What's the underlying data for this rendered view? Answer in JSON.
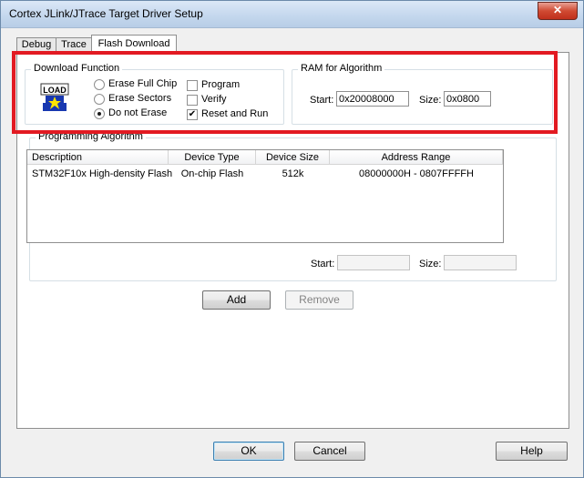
{
  "window": {
    "title": "Cortex JLink/JTrace Target Driver Setup",
    "close_glyph": "✕"
  },
  "tabs": [
    {
      "label": "Debug",
      "active": false
    },
    {
      "label": "Trace",
      "active": false
    },
    {
      "label": "Flash Download",
      "active": true
    }
  ],
  "download_function": {
    "label": "Download Function",
    "icon": "load-icon",
    "icon_text": "LOAD",
    "radios": [
      {
        "label": "Erase Full Chip",
        "selected": false
      },
      {
        "label": "Erase Sectors",
        "selected": false
      },
      {
        "label": "Do not Erase",
        "selected": true
      }
    ],
    "checks": [
      {
        "label": "Program",
        "checked": false
      },
      {
        "label": "Verify",
        "checked": false
      },
      {
        "label": "Reset and Run",
        "checked": true
      }
    ]
  },
  "ram_for_algorithm": {
    "label": "RAM for Algorithm",
    "start_label": "Start:",
    "start_value": "0x20008000",
    "size_label": "Size:",
    "size_value": "0x0800"
  },
  "programming_algorithm": {
    "label": "Programming Algorithm",
    "columns": [
      "Description",
      "Device Type",
      "Device Size",
      "Address Range"
    ],
    "rows": [
      {
        "description": "STM32F10x High-density Flash",
        "device_type": "On-chip Flash",
        "device_size": "512k",
        "address_range": "08000000H - 0807FFFFH"
      }
    ],
    "start_label": "Start:",
    "start_value": "",
    "size_label": "Size:",
    "size_value": "",
    "add_label": "Add",
    "remove_label": "Remove"
  },
  "footer": {
    "ok_label": "OK",
    "cancel_label": "Cancel",
    "help_label": "Help"
  },
  "colors": {
    "highlight": "#e21a22",
    "titlebar": "#c5d8ee",
    "close_button": "#c0301c"
  }
}
